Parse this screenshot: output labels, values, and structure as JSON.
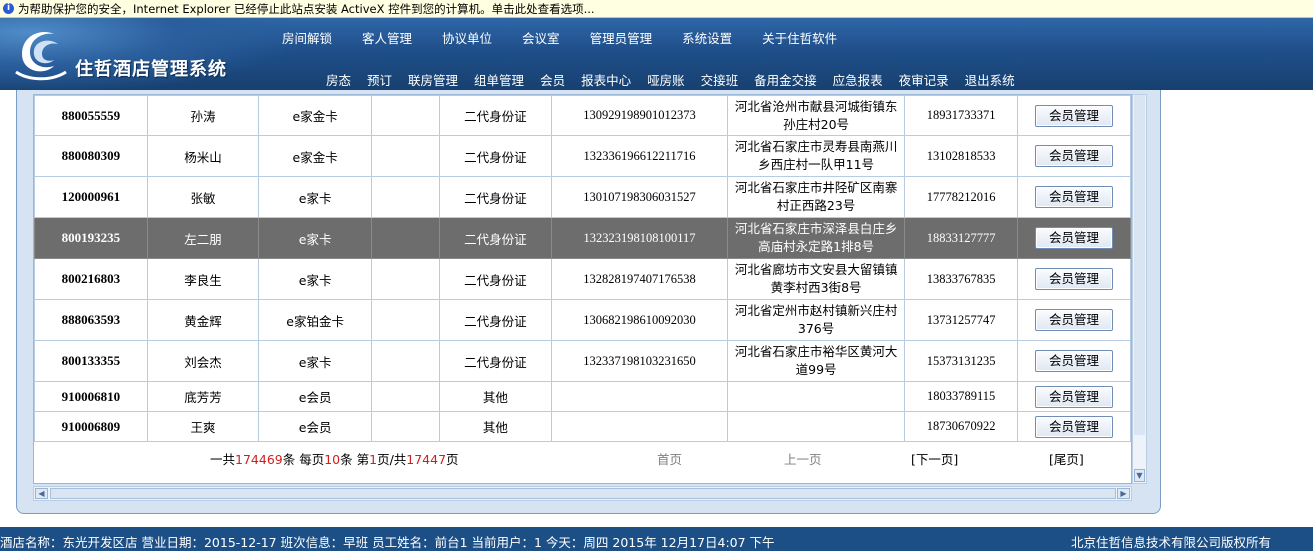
{
  "infobar": {
    "message": "为帮助保护您的安全，Internet Explorer 已经停止此站点安装 ActiveX 控件到您的计算机。单击此处查看选项..."
  },
  "header": {
    "logo_text": "住哲酒店管理系统",
    "menu_primary": [
      "房间解锁",
      "客人管理",
      "协议单位",
      "会议室",
      "管理员管理",
      "系统设置",
      "关于住哲软件"
    ],
    "menu_secondary": [
      "房态",
      "预订",
      "联房管理",
      "组单管理",
      "会员",
      "报表中心",
      "哑房账",
      "交接班",
      "备用金交接",
      "应急报表",
      "夜审记录",
      "退出系统"
    ]
  },
  "table": {
    "action_label": "会员管理",
    "selected_row": 3,
    "rows": [
      {
        "card_no": "880055559",
        "name": "孙涛",
        "card_type": "e家金卡",
        "extra": "",
        "id_type": "二代身份证",
        "id_no": "130929198901012373",
        "address": "河北省沧州市献县河城街镇东孙庄村20号",
        "phone": "18931733371"
      },
      {
        "card_no": "880080309",
        "name": "杨米山",
        "card_type": "e家金卡",
        "extra": "",
        "id_type": "二代身份证",
        "id_no": "132336196612211716",
        "address": "河北省石家庄市灵寿县南燕川乡西庄村一队甲11号",
        "phone": "13102818533"
      },
      {
        "card_no": "120000961",
        "name": "张敏",
        "card_type": "e家卡",
        "extra": "",
        "id_type": "二代身份证",
        "id_no": "130107198306031527",
        "address": "河北省石家庄市井陉矿区南寨村正西路23号",
        "phone": "17778212016"
      },
      {
        "card_no": "800193235",
        "name": "左二朋",
        "card_type": "e家卡",
        "extra": "",
        "id_type": "二代身份证",
        "id_no": "132323198108100117",
        "address": "河北省石家庄市深泽县白庄乡高庙村永定路1排8号",
        "phone": "18833127777"
      },
      {
        "card_no": "800216803",
        "name": "李良生",
        "card_type": "e家卡",
        "extra": "",
        "id_type": "二代身份证",
        "id_no": "132828197407176538",
        "address": "河北省廊坊市文安县大留镇镇黄李村西3街8号",
        "phone": "13833767835"
      },
      {
        "card_no": "888063593",
        "name": "黄金辉",
        "card_type": "e家铂金卡",
        "extra": "",
        "id_type": "二代身份证",
        "id_no": "130682198610092030",
        "address": "河北省定州市赵村镇新兴庄村376号",
        "phone": "13731257747"
      },
      {
        "card_no": "800133355",
        "name": "刘会杰",
        "card_type": "e家卡",
        "extra": "",
        "id_type": "二代身份证",
        "id_no": "132337198103231650",
        "address": "河北省石家庄市裕华区黄河大道99号",
        "phone": "15373131235"
      },
      {
        "card_no": "910006810",
        "name": "底芳芳",
        "card_type": "e会员",
        "extra": "",
        "id_type": "其他",
        "id_no": "",
        "address": "",
        "phone": "18033789115"
      },
      {
        "card_no": "910006809",
        "name": "王爽",
        "card_type": "e会员",
        "extra": "",
        "id_type": "其他",
        "id_no": "",
        "address": "",
        "phone": "18730670922"
      }
    ]
  },
  "pager": {
    "p1": "一共",
    "total": "174469",
    "p2": "条 每页",
    "per_page": "10",
    "p3": "条 第",
    "page": "1",
    "p4": "页/共",
    "pages": "17447",
    "p5": "页",
    "first": "首页",
    "prev": "上一页",
    "next": "[下一页]",
    "last": "[尾页]"
  },
  "status": {
    "left": "酒店名称：东光开发区店  营业日期：2015-12-17  班次信息：早班  员工姓名：前台1  当前用户：1  今天：周四  2015年  12月17日4:07 下午",
    "right": "北京住哲信息技术有限公司版权所有"
  },
  "colors": {
    "header": "#1f4f8a",
    "selected_row": "#6d6d6d",
    "highlight_red": "#d21e1e",
    "status_bar": "#1c4f86"
  }
}
